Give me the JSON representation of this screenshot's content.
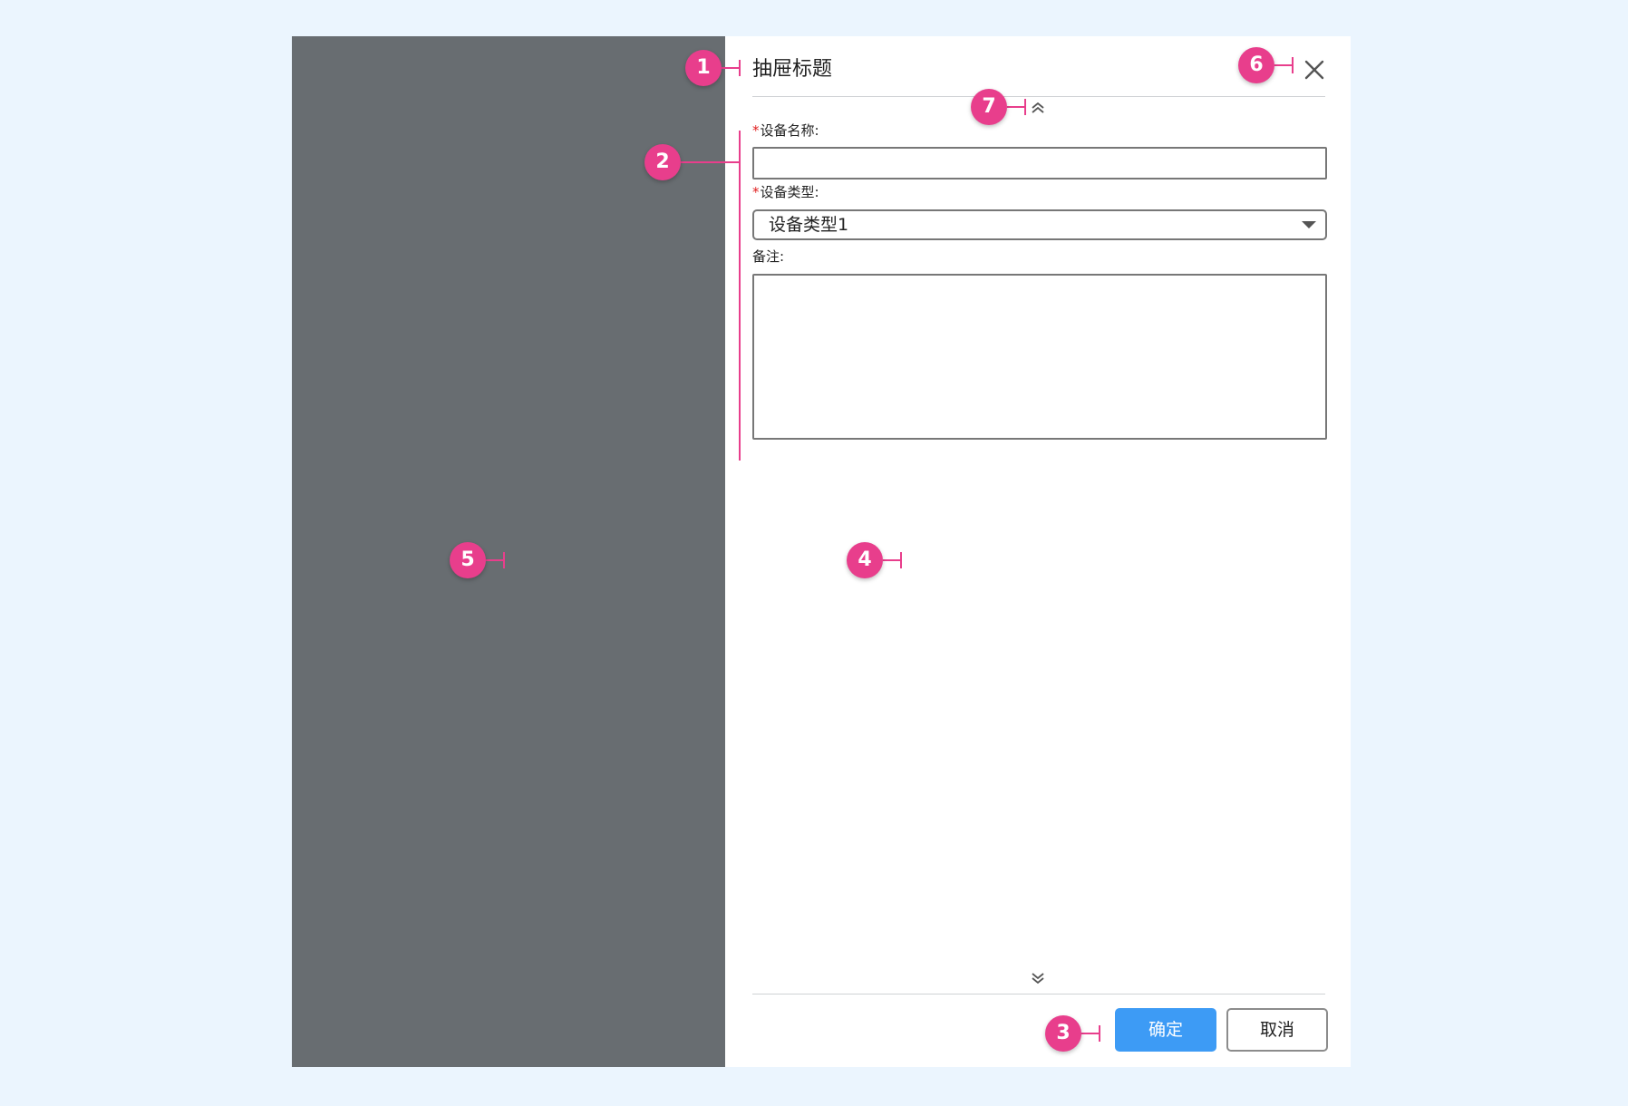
{
  "drawer": {
    "title": "抽屉标题",
    "close_icon": "close-icon",
    "scroll_up_icon": "chevron-double-up-icon",
    "scroll_down_icon": "chevron-double-down-icon"
  },
  "form": {
    "required_mark": "*",
    "device_name": {
      "label": "设备名称:",
      "value": ""
    },
    "device_type": {
      "label": "设备类型:",
      "selected": "设备类型1"
    },
    "remark": {
      "label": "备注:",
      "value": ""
    }
  },
  "footer": {
    "ok_label": "确定",
    "cancel_label": "取消"
  },
  "annotations": [
    "1",
    "2",
    "3",
    "4",
    "5",
    "6",
    "7"
  ],
  "colors": {
    "page_bg": "#ebf5fe",
    "mask": "#686d71",
    "primary": "#3d9bf5",
    "marker": "#e83e8c",
    "required": "#e02020"
  }
}
